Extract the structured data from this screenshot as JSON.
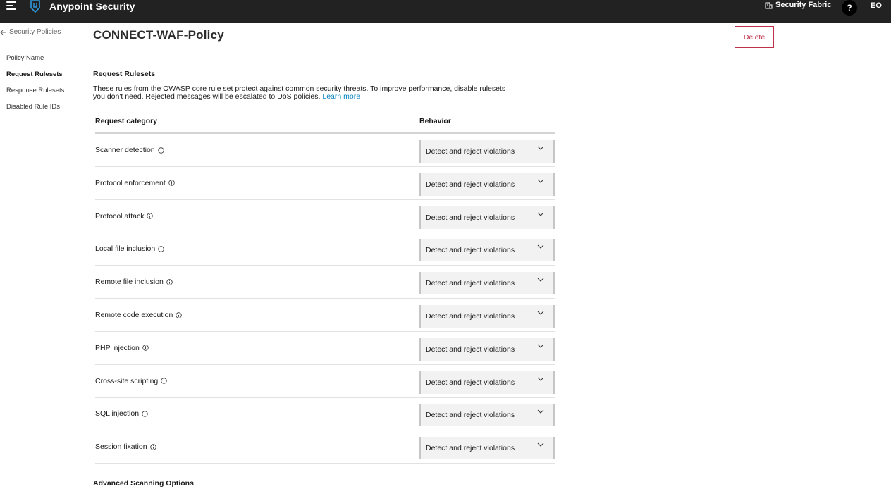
{
  "header": {
    "app_title": "Anypoint Security",
    "fabric_label": "Security Fabric",
    "help_label": "?",
    "avatar_initials": "EO"
  },
  "sidebar": {
    "back_label": "Security Policies",
    "items": [
      {
        "label": "Policy Name",
        "active": false
      },
      {
        "label": "Request Rulesets",
        "active": true
      },
      {
        "label": "Response Rulesets",
        "active": false
      },
      {
        "label": "Disabled Rule IDs",
        "active": false
      }
    ]
  },
  "main": {
    "title": "CONNECT-WAF-Policy",
    "delete_label": "Delete",
    "section_heading": "Request Rulesets",
    "description_line1": "These rules from the OWASP core rule set protect against common security threats. To improve performance, disable rulesets",
    "description_line2": "you don't need. Rejected messages will be escalated to DoS policies.",
    "learn_more": "Learn more",
    "table": {
      "col_category": "Request category",
      "col_behavior": "Behavior",
      "rows": [
        {
          "category": "Scanner detection",
          "behavior": "Detect and reject violations"
        },
        {
          "category": "Protocol enforcement",
          "behavior": "Detect and reject violations"
        },
        {
          "category": "Protocol attack",
          "behavior": "Detect and reject violations"
        },
        {
          "category": "Local file inclusion",
          "behavior": "Detect and reject violations"
        },
        {
          "category": "Remote file inclusion",
          "behavior": "Detect and reject violations"
        },
        {
          "category": "Remote code execution",
          "behavior": "Detect and reject violations"
        },
        {
          "category": "PHP injection",
          "behavior": "Detect and reject violations"
        },
        {
          "category": "Cross-site scripting",
          "behavior": "Detect and reject violations"
        },
        {
          "category": "SQL injection",
          "behavior": "Detect and reject violations"
        },
        {
          "category": "Session fixation",
          "behavior": "Detect and reject violations"
        }
      ]
    },
    "advanced_heading": "Advanced Scanning Options"
  },
  "colors": {
    "topbar": "#222222",
    "delete_accent": "#c0304a",
    "link": "#0a84c1"
  }
}
